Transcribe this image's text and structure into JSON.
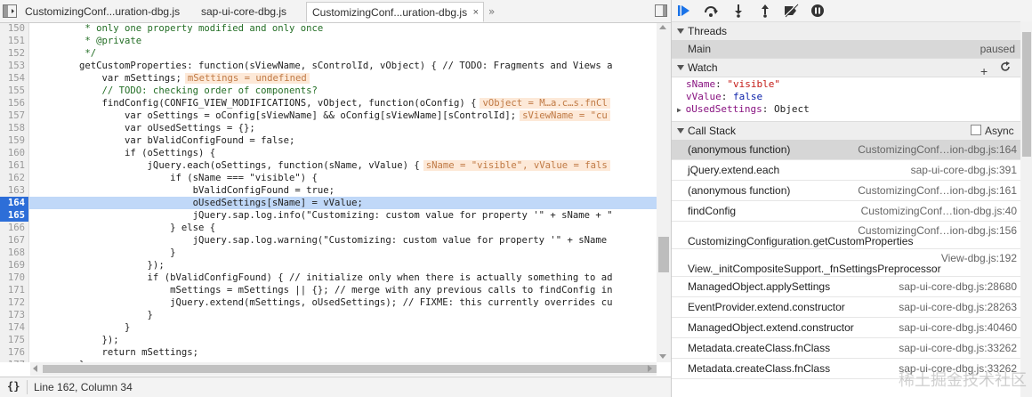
{
  "tabs": [
    {
      "label": "CustomizingConf...uration-dbg.js",
      "active": false
    },
    {
      "label": "sap-ui-core-dbg.js",
      "active": false
    },
    {
      "label": "CustomizingConf...uration-dbg.js",
      "active": true
    }
  ],
  "tab_overflow": "»",
  "tab_close": "×",
  "editor": {
    "lines": [
      {
        "n": "150",
        "text": "         * only one property modified and only once",
        "kind": "cm"
      },
      {
        "n": "151",
        "text": "         * @private",
        "kind": "cm"
      },
      {
        "n": "152",
        "text": "         */",
        "kind": "cm"
      },
      {
        "n": "153",
        "text": "        getCustomProperties: function(sViewName, sControlId, vObject) { // TODO: Fragments and Views a",
        "kind": "code"
      },
      {
        "n": "154",
        "text": "            var mSettings;",
        "inline": "mSettings = undefined",
        "kind": "code"
      },
      {
        "n": "155",
        "text": "            // TODO: checking order of components?",
        "kind": "cm"
      },
      {
        "n": "156",
        "text": "            findConfig(CONFIG_VIEW_MODIFICATIONS, vObject, function(oConfig) {",
        "inline": "vObject = M…a.c…s.fnCl",
        "kind": "code"
      },
      {
        "n": "157",
        "text": "                var oSettings = oConfig[sViewName] && oConfig[sViewName][sControlId];",
        "inline": "sViewName = \"cu",
        "kind": "code"
      },
      {
        "n": "158",
        "text": "                var oUsedSettings = {};",
        "kind": "code"
      },
      {
        "n": "159",
        "text": "                var bValidConfigFound = false;",
        "kind": "code"
      },
      {
        "n": "160",
        "text": "                if (oSettings) {",
        "kind": "code"
      },
      {
        "n": "161",
        "text": "                    jQuery.each(oSettings, function(sName, vValue) {",
        "inline": "sName = \"visible\", vValue = fals",
        "kind": "code"
      },
      {
        "n": "162",
        "text": "                        if (sName === \"visible\") {",
        "kind": "code"
      },
      {
        "n": "163",
        "text": "                            bValidConfigFound = true;",
        "kind": "code"
      },
      {
        "n": "164",
        "text": "                            oUsedSettings[sName] = vValue;",
        "kind": "code",
        "breakpoint": true,
        "highlight": true
      },
      {
        "n": "165",
        "text": "                            jQuery.sap.log.info(\"Customizing: custom value for property '\" + sName + \"",
        "kind": "code",
        "breakpoint": true
      },
      {
        "n": "166",
        "text": "                        } else {",
        "kind": "code"
      },
      {
        "n": "167",
        "text": "                            jQuery.sap.log.warning(\"Customizing: custom value for property '\" + sName",
        "kind": "code"
      },
      {
        "n": "168",
        "text": "                        }",
        "kind": "code"
      },
      {
        "n": "169",
        "text": "                    });",
        "kind": "code"
      },
      {
        "n": "170",
        "text": "                    if (bValidConfigFound) { // initialize only when there is actually something to ad",
        "kind": "code"
      },
      {
        "n": "171",
        "text": "                        mSettings = mSettings || {}; // merge with any previous calls to findConfig in",
        "kind": "code"
      },
      {
        "n": "172",
        "text": "                        jQuery.extend(mSettings, oUsedSettings); // FIXME: this currently overrides cu",
        "kind": "code"
      },
      {
        "n": "173",
        "text": "                    }",
        "kind": "code"
      },
      {
        "n": "174",
        "text": "                }",
        "kind": "code"
      },
      {
        "n": "175",
        "text": "            });",
        "kind": "code"
      },
      {
        "n": "176",
        "text": "            return mSettings;",
        "kind": "code"
      },
      {
        "n": "177",
        "text": "        },",
        "kind": "code"
      }
    ]
  },
  "status": {
    "pretty_print": "{}",
    "cursor": "Line 162, Column 34"
  },
  "sidebar": {
    "threads": {
      "title": "Threads",
      "name": "Main",
      "state": "paused"
    },
    "watch": {
      "title": "Watch",
      "add": "+",
      "items": [
        {
          "key": "sName",
          "sep": ": ",
          "value": "\"visible\"",
          "type": "str"
        },
        {
          "key": "vValue",
          "sep": ": ",
          "value": "false",
          "type": "kw"
        },
        {
          "key": "oUsedSettings",
          "sep": ": ",
          "value": "Object",
          "type": "obj",
          "expandable": true
        }
      ]
    },
    "callstack": {
      "title": "Call Stack",
      "async_label": "Async",
      "frames": [
        {
          "fn": "(anonymous function)",
          "loc": "CustomizingConf…ion-dbg.js:164",
          "selected": true
        },
        {
          "fn": "jQuery.extend.each",
          "loc": "sap-ui-core-dbg.js:391"
        },
        {
          "fn": "(anonymous function)",
          "loc": "CustomizingConf…ion-dbg.js:161"
        },
        {
          "fn": "findConfig",
          "loc": "CustomizingConf…tion-dbg.js:40"
        },
        {
          "fn": "CustomizingConfiguration.getCustomProperties",
          "loc": "CustomizingConf…ion-dbg.js:156",
          "tall": true
        },
        {
          "fn": "View._initCompositeSupport._fnSettingsPreprocessor",
          "loc": "View-dbg.js:192",
          "tall": true
        },
        {
          "fn": "ManagedObject.applySettings",
          "loc": "sap-ui-core-dbg.js:28680"
        },
        {
          "fn": "EventProvider.extend.constructor",
          "loc": "sap-ui-core-dbg.js:28263"
        },
        {
          "fn": "ManagedObject.extend.constructor",
          "loc": "sap-ui-core-dbg.js:40460"
        },
        {
          "fn": "Metadata.createClass.fnClass",
          "loc": "sap-ui-core-dbg.js:33262"
        },
        {
          "fn": "Metadata.createClass.fnClass",
          "loc": "sap-ui-core-dbg.js:33262"
        }
      ]
    }
  },
  "watermark": "稀土掘金技术社区",
  "colors": {
    "breakpoint": "#2d6ed8",
    "exec_line": "#c0d8f8",
    "inline_value_bg": "#fde9d8",
    "accent": "#1a73e8"
  }
}
